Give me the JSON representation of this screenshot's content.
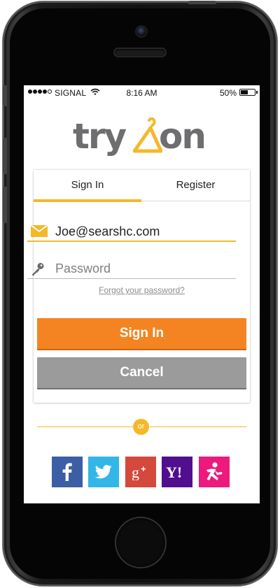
{
  "status_bar": {
    "carrier": "SIGNAL",
    "time": "8:16 AM",
    "battery_percent": "50%",
    "battery_level": 0.5,
    "signal_bars_filled": 4,
    "signal_bars_total": 5
  },
  "logo": {
    "text_left": "try",
    "text_right": "on",
    "text_color": "#6e6e70",
    "accent_color": "#f5b82a"
  },
  "tabs": [
    {
      "label": "Sign In",
      "active": true
    },
    {
      "label": "Register",
      "active": false
    }
  ],
  "form": {
    "email": {
      "value": "Joe@searshc.com",
      "icon": "envelope-icon"
    },
    "password": {
      "value": "",
      "placeholder": "Password",
      "icon": "key-icon"
    },
    "forgot_link": "Forgot your password?",
    "signin_button": "Sign In",
    "cancel_button": "Cancel"
  },
  "divider": {
    "label": "or"
  },
  "social": [
    {
      "name": "facebook-icon",
      "glyph": "f",
      "color": "#3b5ea5"
    },
    {
      "name": "twitter-icon",
      "glyph": "bird",
      "color": "#32b6e8"
    },
    {
      "name": "google-plus-icon",
      "glyph": "g+",
      "color": "#d5483c"
    },
    {
      "name": "yahoo-icon",
      "glyph": "Y!",
      "color": "#510e8e"
    },
    {
      "name": "runner-icon",
      "glyph": "runner",
      "color": "#ec1a7c"
    }
  ],
  "colors": {
    "accent": "#f5b82a",
    "primary_button": "#f48421",
    "secondary_button": "#9b9b9b"
  }
}
